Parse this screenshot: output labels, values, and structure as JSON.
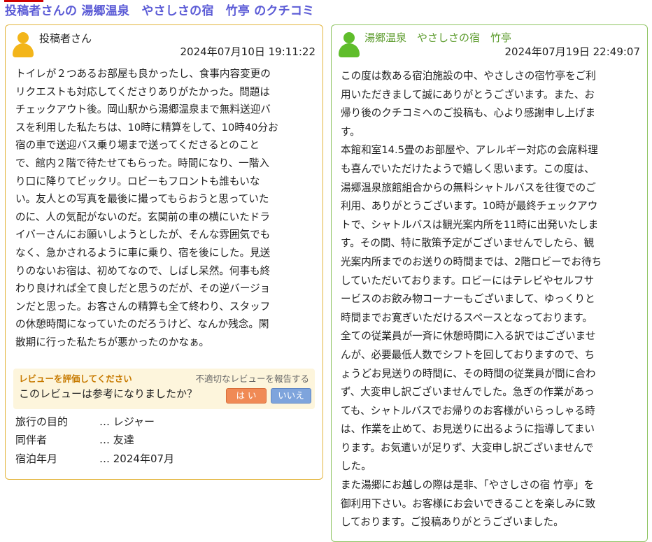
{
  "page_title": "投稿者さんの 湯郷温泉　やさしさの宿　竹亭 のクチコミ",
  "colors": {
    "title": "#5b5bd6",
    "left_border": "#e3b53e",
    "right_border": "#8ec462",
    "response_name": "#5a9a2a"
  },
  "review": {
    "avatar_icon": "person-orange-icon",
    "author": "投稿者さん",
    "datetime": "2024年07月10日 19:11:22",
    "body_lines": [
      "トイレが２つあるお部屋も良かったし、食事内容変更の",
      "リクエストも対応してくださりありがたかった。問題は",
      "チェックアウト後。岡山駅から湯郷温泉まで無料送迎バ",
      "スを利用した私たちは、10時に精算をして、10時40分お",
      "宿の車で送迎バス乗り場まで送ってくださるとのこと",
      "で、館内２階で待たせてもらった。時間になり、一階入",
      "り口に降りてビックリ。ロビーもフロントも誰もいな",
      "い。友人との写真を最後に撮ってもらおうと思っていた",
      "のに、人の気配がないのだ。玄関前の車の横にいたドラ",
      "イバーさんにお願いしようとしたが、そんな雰囲気でも",
      "なく、急かされるように車に乗り、宿を後にした。見送",
      "りのないお宿は、初めてなので、しばし呆然。何事も終",
      "わり良ければ全て良しだと思うのだが、その逆バージョ",
      "ンだと思った。お客さんの精算も全て終わり、スタッフ",
      "の休憩時間になっていたのだろうけど、なんか残念。閑",
      "散期に行った私たちが悪かったのかなぁ。"
    ],
    "vote": {
      "heading": "レビューを評価してください",
      "report_link": "不適切なレビューを報告する",
      "question": "このレビューは参考になりましたか？",
      "yes_label": "は い",
      "no_label": "いいえ"
    },
    "meta": [
      {
        "label": "旅行の目的",
        "value": "… レジャー"
      },
      {
        "label": "同伴者",
        "value": "… 友達"
      },
      {
        "label": "宿泊年月",
        "value": "… 2024年07月"
      }
    ]
  },
  "response": {
    "avatar_icon": "person-green-icon",
    "author": "湯郷温泉　やさしさの宿　竹亭",
    "datetime": "2024年07月19日 22:49:07",
    "body_lines": [
      "この度は数ある宿泊施設の中、やさしさの宿竹亭をご利",
      "用いただきまして誠にありがとうございます。また、お",
      "帰り後のクチコミへのご投稿も、心より感謝申し上げま",
      "す。",
      "本館和室14.5畳のお部屋や、アレルギー対応の会席料理",
      "も喜んでいただけたようで嬉しく思います。この度は、",
      "湯郷温泉旅館組合からの無料シャトルバスを往復でのご",
      "利用、ありがとうございます。10時が最終チェックアウ",
      "トで、シャトルバスは観光案内所を11時に出発いたしま",
      "す。その間、特に散策予定がございませんでしたら、観",
      "光案内所までのお送りの時間までは、2階ロビーでお待ち",
      "していただいております。ロビーにはテレビやセルフサ",
      "ービスのお飲み物コーナーもございまして、ゆっくりと",
      "時間までお寛ぎいただけるスペースとなっております。",
      "全ての従業員が一斉に休憩時間に入る訳ではございませ",
      "んが、必要最低人数でシフトを回しておりますので、ち",
      "ょうどお見送りの時間に、その時間の従業員が間に合わ",
      "ず、大変申し訳ございませんでした。急ぎの作業があっ",
      "ても、シャトルバスでお帰りのお客様がいらっしゃる時",
      "は、作業を止めて、お見送りに出るように指導してまい",
      "ります。お気遣いが足りず、大変申し訳ございませんで",
      "した。",
      "また湯郷にお越しの際は是非、「やさしさの宿 竹亭」を",
      "御利用下さい。お客様にお会いできることを楽しみに致",
      "しております。ご投稿ありがとうございました。"
    ]
  }
}
